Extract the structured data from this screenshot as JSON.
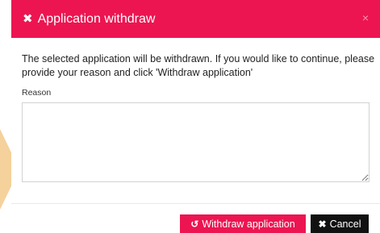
{
  "modal": {
    "title": "Application withdraw",
    "title_icon": "✖",
    "close_glyph": "×",
    "message": "The selected application will be withdrawn. If you would like to continue, please provide your reason and click 'Withdraw application'",
    "reason_label": "Reason",
    "reason_value": ""
  },
  "buttons": {
    "withdraw_label": "Withdraw application",
    "withdraw_icon": "↺",
    "cancel_label": "Cancel",
    "cancel_icon": "✖"
  },
  "colors": {
    "accent": "#ec1551",
    "cancel_bg": "#111111"
  },
  "icons": {
    "title": "times-icon",
    "close": "close-icon",
    "withdraw": "undo-icon",
    "cancel": "times-icon"
  }
}
